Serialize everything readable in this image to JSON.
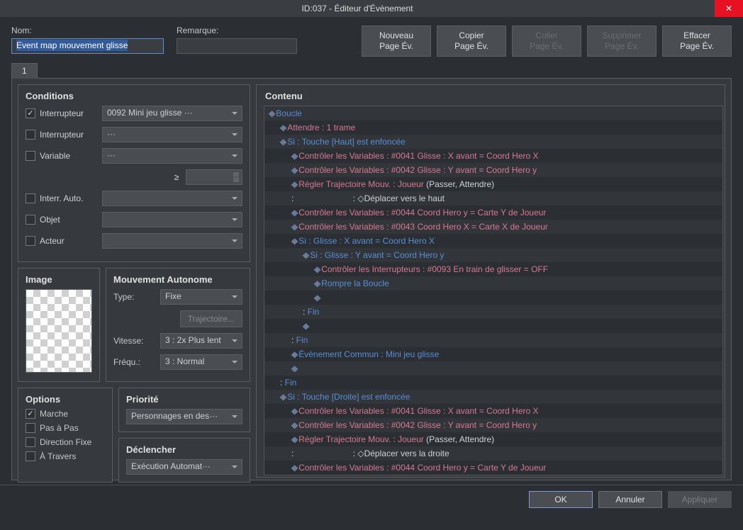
{
  "window": {
    "title": "ID:037 - Éditeur d'Évènement",
    "close_label": "✕"
  },
  "header": {
    "name_label": "Nom:",
    "name_value": "Event map mouvement glisse",
    "note_label": "Remarque:",
    "note_value": "",
    "buttons": [
      {
        "l1": "Nouveau",
        "l2": "Page Év.",
        "disabled": false
      },
      {
        "l1": "Copier",
        "l2": "Page Év.",
        "disabled": false
      },
      {
        "l1": "Coller",
        "l2": "Page Év.",
        "disabled": true
      },
      {
        "l1": "Supprimer",
        "l2": "Page Év.",
        "disabled": true
      },
      {
        "l1": "Effacer",
        "l2": "Page Év.",
        "disabled": false
      }
    ]
  },
  "tab": {
    "label": "1"
  },
  "conditions": {
    "title": "Conditions",
    "rows": [
      {
        "label": "Interrupteur",
        "checked": true,
        "value": "0092 Mini jeu glisse ···"
      },
      {
        "label": "Interrupteur",
        "checked": false,
        "value": "···"
      },
      {
        "label": "Variable",
        "checked": false,
        "value": "···"
      }
    ],
    "geq_sym": "≥",
    "rows2": [
      {
        "label": "Interr. Auto.",
        "value": ""
      },
      {
        "label": "Objet",
        "value": ""
      },
      {
        "label": "Acteur",
        "value": ""
      }
    ]
  },
  "image": {
    "title": "Image"
  },
  "movement": {
    "title": "Mouvement Autonome",
    "type_label": "Type:",
    "type_value": "Fixe",
    "traj_label": "Trajectoire...",
    "speed_label": "Vitesse:",
    "speed_value": "3 : 2x Plus lent",
    "freq_label": "Fréqu.:",
    "freq_value": "3 : Normal"
  },
  "options": {
    "title": "Options",
    "items": [
      {
        "label": "Marche",
        "checked": true
      },
      {
        "label": "Pas à Pas",
        "checked": false
      },
      {
        "label": "Direction Fixe",
        "checked": false
      },
      {
        "label": "À Travers",
        "checked": false
      }
    ]
  },
  "priority": {
    "title": "Priorité",
    "value": "Personnages en des···"
  },
  "trigger": {
    "title": "Déclencher",
    "value": "Exécution Automat···"
  },
  "content": {
    "title": "Contenu",
    "lines": [
      {
        "indent": 0,
        "parts": [
          {
            "t": "◆",
            "c": "diamond"
          },
          {
            "t": "Boucle",
            "c": "c-blue"
          }
        ]
      },
      {
        "indent": 1,
        "parts": [
          {
            "t": "◆",
            "c": "diamond"
          },
          {
            "t": "Attendre",
            "c": "c-pink"
          },
          {
            "t": " : 1 trame",
            "c": "c-pink"
          }
        ]
      },
      {
        "indent": 1,
        "parts": [
          {
            "t": "◆",
            "c": "diamond"
          },
          {
            "t": "Si",
            "c": "c-blue"
          },
          {
            "t": " : Touche [Haut] est enfoncée",
            "c": "c-blue"
          }
        ]
      },
      {
        "indent": 2,
        "parts": [
          {
            "t": "◆",
            "c": "diamond"
          },
          {
            "t": "Contrôler les Variables",
            "c": "c-pink"
          },
          {
            "t": " : #0041 Glisse : X avant = Coord Hero X",
            "c": "c-pink"
          }
        ]
      },
      {
        "indent": 2,
        "parts": [
          {
            "t": "◆",
            "c": "diamond"
          },
          {
            "t": "Contrôler les Variables",
            "c": "c-pink"
          },
          {
            "t": " : #0042 Glisse : Y avant = Coord Hero y",
            "c": "c-pink"
          }
        ]
      },
      {
        "indent": 2,
        "parts": [
          {
            "t": "◆",
            "c": "diamond"
          },
          {
            "t": "Régler Trajectoire Mouv.",
            "c": "c-pink"
          },
          {
            "t": " : Joueur",
            "c": "c-pink"
          },
          {
            "t": " (Passer, Attendre)",
            "c": "c-white"
          }
        ]
      },
      {
        "indent": 2,
        "parts": [
          {
            "t": ":",
            "c": "c-white"
          },
          {
            "t": "                         : ◇Déplacer vers le haut",
            "c": "c-white"
          }
        ]
      },
      {
        "indent": 2,
        "parts": [
          {
            "t": "◆",
            "c": "diamond"
          },
          {
            "t": "Contrôler les Variables",
            "c": "c-pink"
          },
          {
            "t": " : #0044 Coord Hero y = Carte Y de Joueur",
            "c": "c-pink"
          }
        ]
      },
      {
        "indent": 2,
        "parts": [
          {
            "t": "◆",
            "c": "diamond"
          },
          {
            "t": "Contrôler les Variables",
            "c": "c-pink"
          },
          {
            "t": " : #0043 Coord Hero X = Carte X de Joueur",
            "c": "c-pink"
          }
        ]
      },
      {
        "indent": 2,
        "parts": [
          {
            "t": "◆",
            "c": "diamond"
          },
          {
            "t": "Si",
            "c": "c-blue"
          },
          {
            "t": " : Glisse : X avant = Coord Hero X",
            "c": "c-blue"
          }
        ]
      },
      {
        "indent": 3,
        "parts": [
          {
            "t": "◆",
            "c": "diamond"
          },
          {
            "t": "Si",
            "c": "c-blue"
          },
          {
            "t": " : Glisse : Y avant = Coord Hero y",
            "c": "c-blue"
          }
        ]
      },
      {
        "indent": 4,
        "parts": [
          {
            "t": "◆",
            "c": "diamond"
          },
          {
            "t": "Contrôler les Interrupteurs",
            "c": "c-pink"
          },
          {
            "t": " : #0093 En train de glisser = OFF",
            "c": "c-pink"
          }
        ]
      },
      {
        "indent": 4,
        "parts": [
          {
            "t": "◆",
            "c": "diamond"
          },
          {
            "t": "Rompre la Boucle",
            "c": "c-blue"
          }
        ]
      },
      {
        "indent": 4,
        "parts": [
          {
            "t": "◆",
            "c": "diamond"
          }
        ]
      },
      {
        "indent": 3,
        "parts": [
          {
            "t": ": ",
            "c": "c-white"
          },
          {
            "t": "Fin",
            "c": "c-blue"
          }
        ]
      },
      {
        "indent": 3,
        "parts": [
          {
            "t": "◆",
            "c": "diamond"
          }
        ]
      },
      {
        "indent": 2,
        "parts": [
          {
            "t": ": ",
            "c": "c-white"
          },
          {
            "t": "Fin",
            "c": "c-blue"
          }
        ]
      },
      {
        "indent": 2,
        "parts": [
          {
            "t": "◆",
            "c": "diamond"
          },
          {
            "t": "Évènement Commun",
            "c": "c-blue"
          },
          {
            "t": " : Mini jeu glisse",
            "c": "c-blue"
          }
        ]
      },
      {
        "indent": 2,
        "parts": [
          {
            "t": "◆",
            "c": "diamond"
          }
        ]
      },
      {
        "indent": 1,
        "parts": [
          {
            "t": ": ",
            "c": "c-white"
          },
          {
            "t": "Fin",
            "c": "c-blue"
          }
        ]
      },
      {
        "indent": 1,
        "parts": [
          {
            "t": "◆",
            "c": "diamond"
          },
          {
            "t": "Si",
            "c": "c-blue"
          },
          {
            "t": " : Touche [Droite] est enfoncée",
            "c": "c-blue"
          }
        ]
      },
      {
        "indent": 2,
        "parts": [
          {
            "t": "◆",
            "c": "diamond"
          },
          {
            "t": "Contrôler les Variables",
            "c": "c-pink"
          },
          {
            "t": " : #0041 Glisse : X avant = Coord Hero X",
            "c": "c-pink"
          }
        ]
      },
      {
        "indent": 2,
        "parts": [
          {
            "t": "◆",
            "c": "diamond"
          },
          {
            "t": "Contrôler les Variables",
            "c": "c-pink"
          },
          {
            "t": " : #0042 Glisse : Y avant = Coord Hero y",
            "c": "c-pink"
          }
        ]
      },
      {
        "indent": 2,
        "parts": [
          {
            "t": "◆",
            "c": "diamond"
          },
          {
            "t": "Régler Trajectoire Mouv.",
            "c": "c-pink"
          },
          {
            "t": " : Joueur",
            "c": "c-pink"
          },
          {
            "t": " (Passer, Attendre)",
            "c": "c-white"
          }
        ]
      },
      {
        "indent": 2,
        "parts": [
          {
            "t": ":",
            "c": "c-white"
          },
          {
            "t": "                         : ◇Déplacer vers la droite",
            "c": "c-white"
          }
        ]
      },
      {
        "indent": 2,
        "parts": [
          {
            "t": "◆",
            "c": "diamond"
          },
          {
            "t": "Contrôler les Variables",
            "c": "c-pink"
          },
          {
            "t": " : #0044 Coord Hero y = Carte Y de Joueur",
            "c": "c-pink"
          }
        ]
      }
    ]
  },
  "footer": {
    "ok": "OK",
    "cancel": "Annuler",
    "apply": "Appliquer"
  }
}
